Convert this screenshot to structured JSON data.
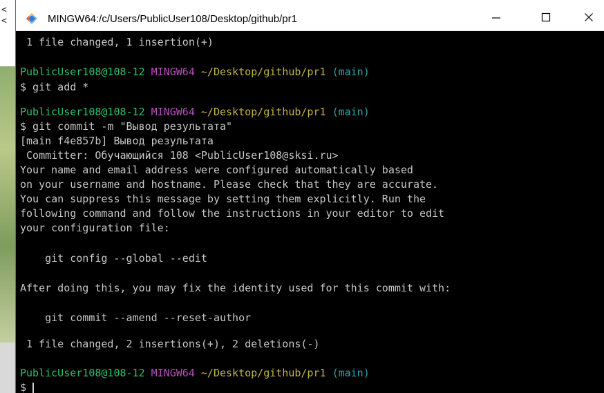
{
  "window": {
    "title": "MINGW64:/c/Users/PublicUser108/Desktop/github/pr1",
    "minimize_glyph": "—",
    "maximize_glyph": "☐",
    "close_glyph": "✕"
  },
  "desktop": {
    "edge_glyph_1": "<",
    "edge_glyph_2": "<"
  },
  "colors": {
    "prompt_user": "#29c26b",
    "prompt_host": "#b84fbf",
    "prompt_path": "#c5b640",
    "prompt_branch": "#2aa5b3",
    "output_text": "#c8c8c8",
    "background": "#000000"
  },
  "terminal": {
    "lines": {
      "l0": " 1 file changed, 1 insertion(+)",
      "p1_user": "PublicUser108@108-12",
      "p1_host": "MINGW64",
      "p1_path": "~/Desktop/github/pr1",
      "p1_branch": "(main)",
      "c1": "$ git add *",
      "p2_user": "PublicUser108@108-12",
      "p2_host": "MINGW64",
      "p2_path": "~/Desktop/github/pr1",
      "p2_branch": "(main)",
      "c2": "$ git commit -m \"Вывод результата\"",
      "o1": "[main f4e857b] Вывод результата",
      "o2": " Committer: Обучающийся 108 <PublicUser108@sksi.ru>",
      "o3": "Your name and email address were configured automatically based",
      "o4": "on your username and hostname. Please check that they are accurate.",
      "o5": "You can suppress this message by setting them explicitly. Run the",
      "o6": "following command and follow the instructions in your editor to edit",
      "o7": "your configuration file:",
      "o8": "    git config --global --edit",
      "o9": "After doing this, you may fix the identity used for this commit with:",
      "o10": "    git commit --amend --reset-author",
      "o11": " 1 file changed, 2 insertions(+), 2 deletions(-)",
      "p3_user": "PublicUser108@108-12",
      "p3_host": "MINGW64",
      "p3_path": "~/Desktop/github/pr1",
      "p3_branch": "(main)",
      "c3": "$ "
    }
  }
}
